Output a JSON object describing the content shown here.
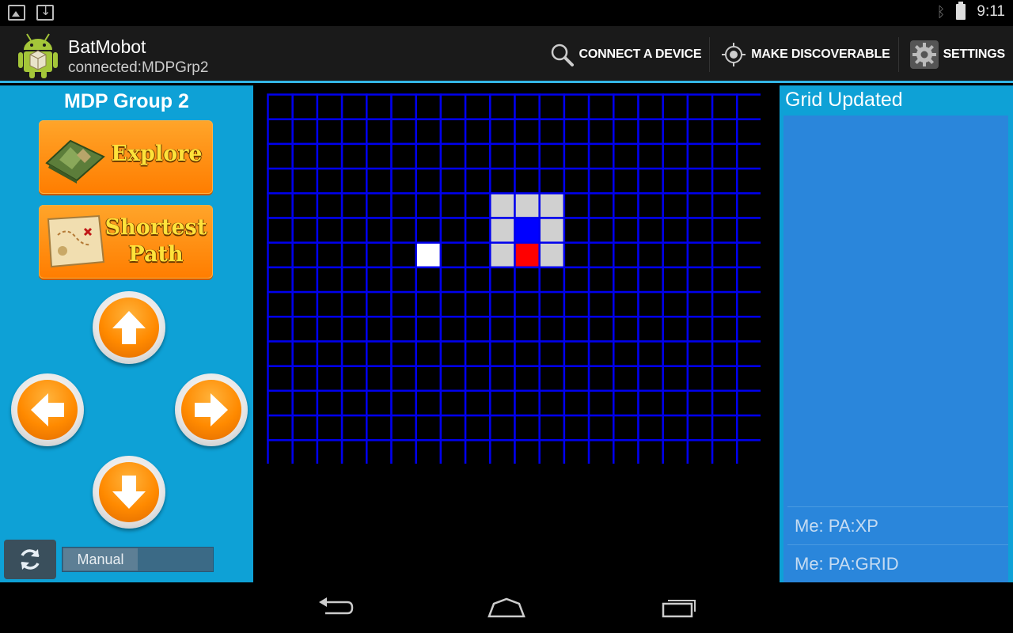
{
  "status_bar": {
    "time": "9:11",
    "icons": [
      "picture-icon",
      "download-icon",
      "bluetooth-icon",
      "battery-icon"
    ]
  },
  "action_bar": {
    "title": "BatMobot",
    "subtitle": "connected:MDPGrp2",
    "actions": [
      {
        "label": "CONNECT A DEVICE",
        "icon": "search-icon"
      },
      {
        "label": "MAKE DISCOVERABLE",
        "icon": "target-icon"
      },
      {
        "label": "SETTINGS",
        "icon": "gear-icon"
      }
    ]
  },
  "controls": {
    "group_title": "MDP Group 2",
    "explore_label": "Explore",
    "shortest_label_1": "Shortest",
    "shortest_label_2": "Path",
    "mode_label": "Manual"
  },
  "grid": {
    "cols": 20,
    "rows": 15,
    "colors": {
      "background": "#000000",
      "border": "#0000ee",
      "robot_body": "#d0d0d0",
      "robot_center": "#0000ff",
      "robot_head": "#ff0000",
      "obstacle": "#ffffff"
    },
    "robot_body_cells": [
      [
        4,
        9
      ],
      [
        4,
        10
      ],
      [
        4,
        11
      ],
      [
        5,
        9
      ],
      [
        5,
        11
      ],
      [
        6,
        9
      ],
      [
        6,
        11
      ]
    ],
    "robot_center_cell": [
      5,
      10
    ],
    "robot_head_cell": [
      6,
      10
    ],
    "obstacle_cells": [
      [
        6,
        6
      ]
    ]
  },
  "status_panel": {
    "title": "Grid Updated",
    "messages": [
      "Me:  PA:XP",
      "Me:  PA:GRID"
    ]
  },
  "colors": {
    "panel": "#0ea1d6",
    "accent": "#33b5e5",
    "orange": "#ff8a00"
  }
}
